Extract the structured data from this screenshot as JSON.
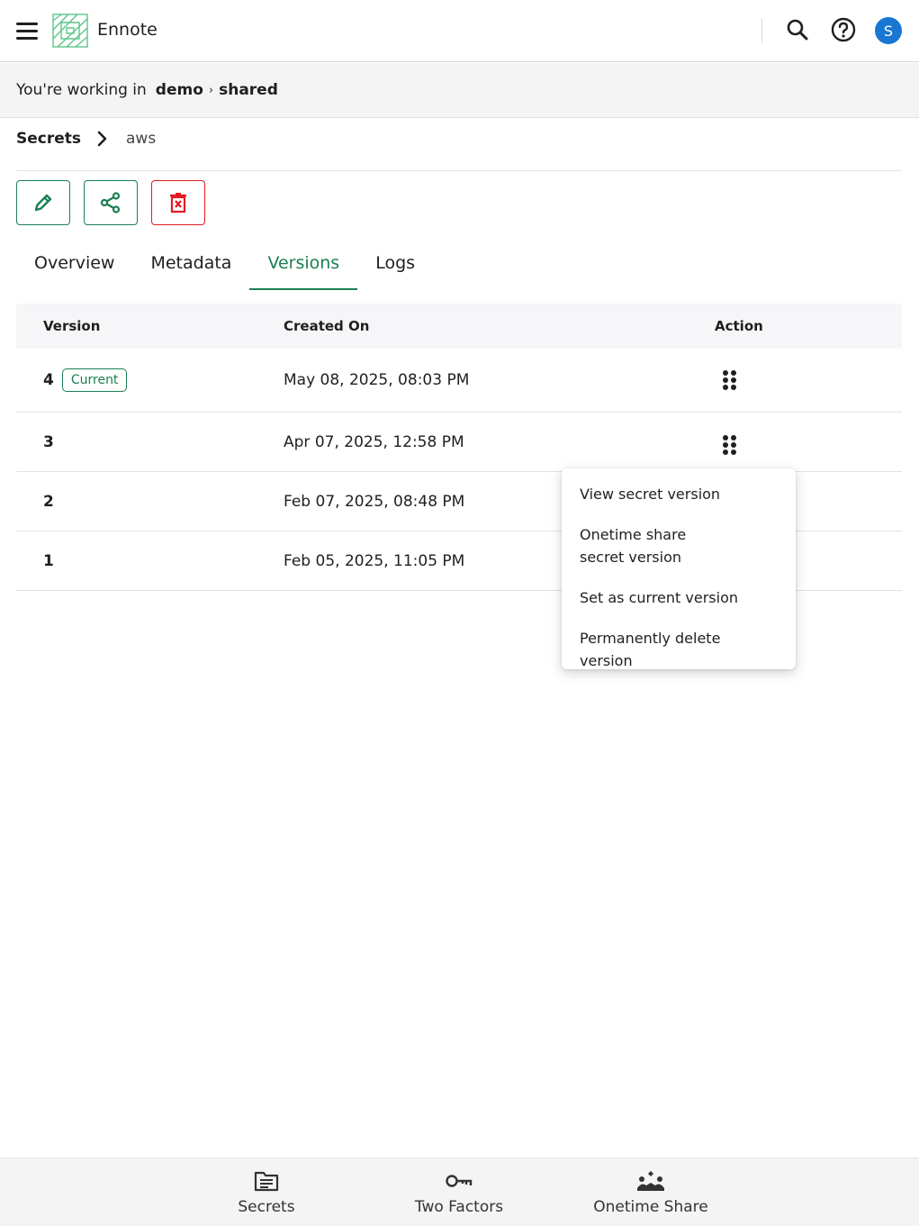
{
  "header": {
    "app_title": "Ennote",
    "avatar_initial": "S",
    "icons": [
      "menu-icon",
      "ennote-logo",
      "search-icon",
      "help-icon"
    ]
  },
  "context": {
    "label": "You're working in",
    "path": [
      "demo",
      "shared"
    ]
  },
  "breadcrumb": {
    "root": "Secrets",
    "current": "aws"
  },
  "actions": [
    {
      "name": "edit",
      "icon": "pencil-icon"
    },
    {
      "name": "share",
      "icon": "share-icon"
    },
    {
      "name": "delete",
      "icon": "trash-icon"
    }
  ],
  "tabs": [
    {
      "label": "Overview"
    },
    {
      "label": "Metadata"
    },
    {
      "label": "Versions",
      "active": true
    },
    {
      "label": "Logs"
    }
  ],
  "table": {
    "columns": [
      "Version",
      "Created On",
      "Action"
    ],
    "rows": [
      {
        "version": "4",
        "badge": "Current",
        "created": "May 08, 2025, 08:03 PM"
      },
      {
        "version": "3",
        "badge": "",
        "created": "Apr 07, 2025, 12:58 PM"
      },
      {
        "version": "2",
        "badge": "",
        "created": "Feb 07, 2025, 08:48 PM"
      },
      {
        "version": "1",
        "badge": "",
        "created": "Feb 05, 2025, 11:05 PM"
      }
    ]
  },
  "menu": {
    "items": [
      "View secret version",
      "Onetime share secret version",
      "Set as current version",
      "Permanently delete version"
    ]
  },
  "bottom_nav": [
    {
      "label": "Secrets",
      "icon": "document-icon"
    },
    {
      "label": "Two Factors",
      "icon": "key-icon"
    },
    {
      "label": "Onetime Share",
      "icon": "people-share-icon"
    }
  ],
  "colors": {
    "accent": "#1a7f52",
    "danger": "#e31b23",
    "avatar": "#1976d2"
  }
}
